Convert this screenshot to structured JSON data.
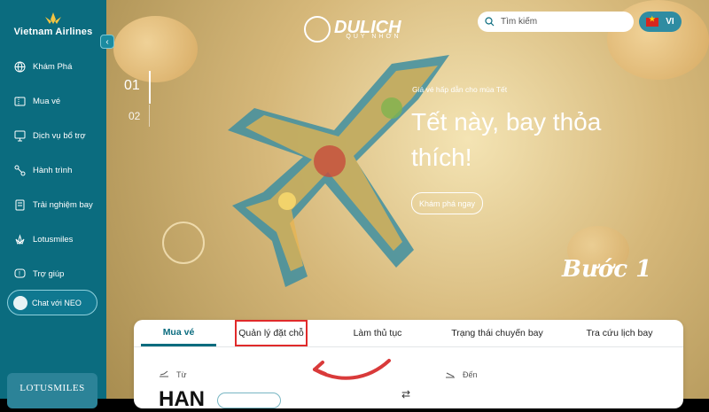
{
  "sidebar": {
    "brand": "Vietnam Airlines",
    "items": [
      {
        "label": "Khám Phá",
        "icon": "globe-icon"
      },
      {
        "label": "Mua vé",
        "icon": "ticket-icon"
      },
      {
        "label": "Dịch vụ bổ trợ",
        "icon": "service-icon"
      },
      {
        "label": "Hành trình",
        "icon": "route-icon"
      },
      {
        "label": "Trải nghiệm bay",
        "icon": "document-icon"
      },
      {
        "label": "Lotusmiles",
        "icon": "lotus-icon"
      },
      {
        "label": "Trợ giúp",
        "icon": "help-icon"
      }
    ],
    "chat_button": "Chat với NEO",
    "lotusmiles_banner": "LOTUSMILES"
  },
  "header": {
    "watermark_title": "DULICH",
    "watermark_subtitle": "QUY NHƠN",
    "search_placeholder": "Tìm kiếm",
    "language": "VI"
  },
  "hero": {
    "slide_active": "01",
    "slide_other": "02",
    "promo_small": "Giá vé hấp dẫn cho mùa Tết",
    "promo_title": "Tết này, bay thỏa thích!",
    "explore_label": "Khám phá ngay",
    "step_label": "Bước 1"
  },
  "booking": {
    "tabs": [
      {
        "label": "Mua vé"
      },
      {
        "label": "Quản lý đặt chỗ"
      },
      {
        "label": "Làm thủ tục"
      },
      {
        "label": "Trạng thái chuyến bay"
      },
      {
        "label": "Tra cứu lịch bay"
      }
    ],
    "from_label": "Từ",
    "to_label": "Đến",
    "from_code": "HAN"
  },
  "colors": {
    "primary": "#0b6c7f",
    "highlight": "#e02a2a",
    "arrow": "#d93a3a"
  }
}
